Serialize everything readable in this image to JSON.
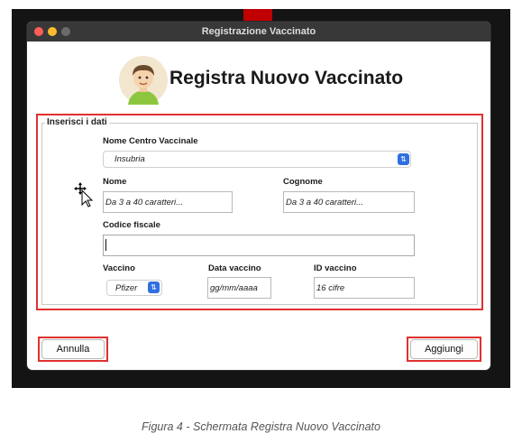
{
  "window": {
    "title": "Registrazione Vaccinato"
  },
  "header": {
    "title": "Registra Nuovo Vaccinato"
  },
  "form": {
    "legend": "Inserisci i dati",
    "centro": {
      "label": "Nome Centro Vaccinale",
      "value": "Insubria"
    },
    "nome": {
      "label": "Nome",
      "placeholder": "Da 3 a 40 caratteri..."
    },
    "cognome": {
      "label": "Cognome",
      "placeholder": "Da 3 a 40 caratteri..."
    },
    "codice_fiscale": {
      "label": "Codice fiscale",
      "value": ""
    },
    "vaccino": {
      "label": "Vaccino",
      "value": "Pfizer"
    },
    "data_vaccino": {
      "label": "Data vaccino",
      "placeholder": "gg/mm/aaaa"
    },
    "id_vaccino": {
      "label": "ID vaccino",
      "placeholder": "16 cifre"
    }
  },
  "buttons": {
    "cancel": "Annulla",
    "submit": "Aggiungi"
  },
  "caption": "Figura 4 - Schermata Registra Nuovo Vaccinato",
  "colors": {
    "highlight": "#e03030",
    "select_accent": "#2f6fe0",
    "titlebar": "#383838"
  },
  "icons": {
    "avatar": "user-avatar-icon",
    "cursor": "move-cursor-icon",
    "chevron": "updown-chevron-icon"
  }
}
